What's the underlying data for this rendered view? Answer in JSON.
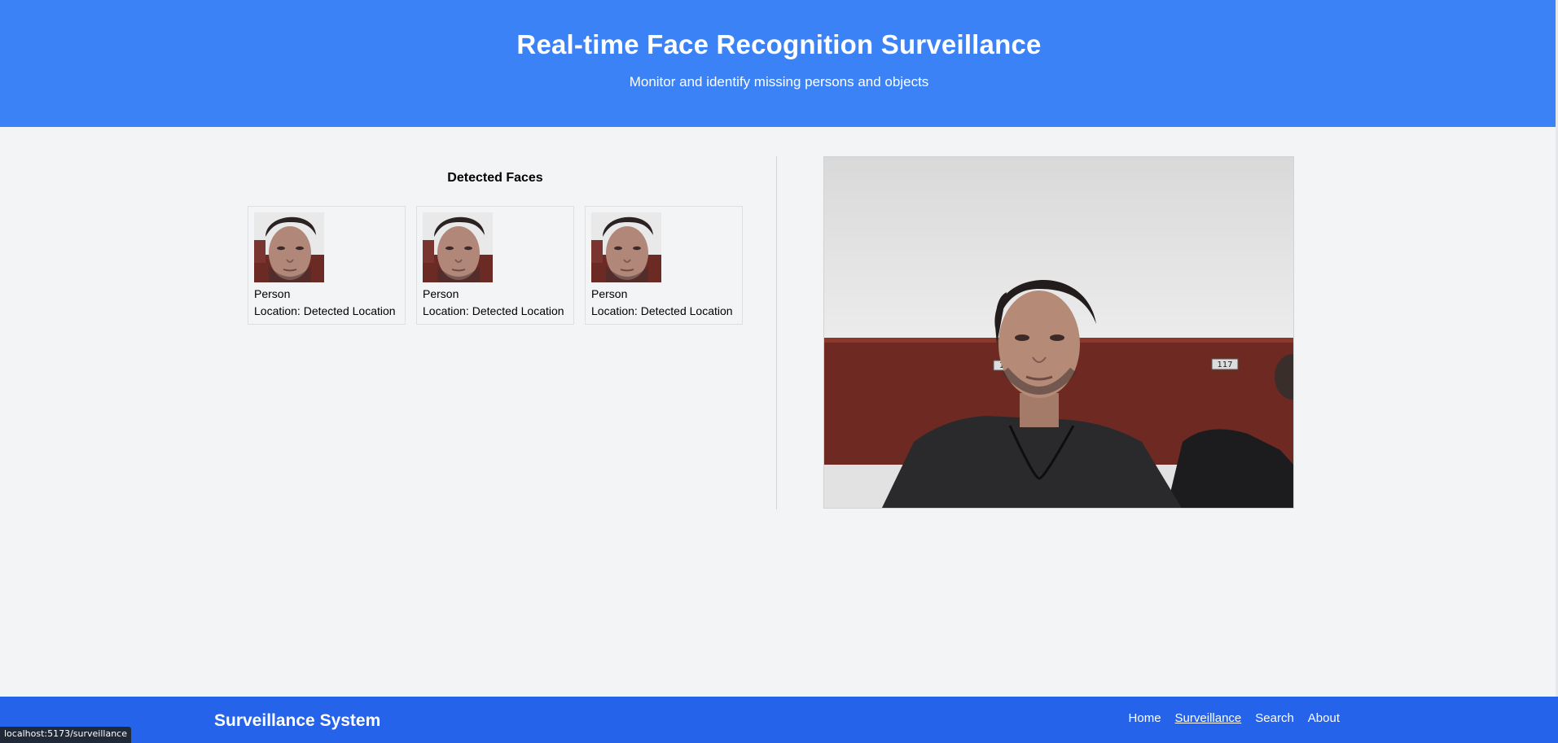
{
  "header": {
    "title": "Real-time Face Recognition Surveillance",
    "subtitle": "Monitor and identify missing persons and objects"
  },
  "detected_faces": {
    "title": "Detected Faces",
    "items": [
      {
        "name": "Person",
        "location": "Location: Detected Location"
      },
      {
        "name": "Person",
        "location": "Location: Detected Location"
      },
      {
        "name": "Person",
        "location": "Location: Detected Location"
      }
    ]
  },
  "camera_feed": {
    "seat_labels": [
      "1",
      "117"
    ]
  },
  "footer": {
    "brand": "Surveillance System",
    "nav": [
      {
        "label": "Home",
        "active": false
      },
      {
        "label": "Surveillance",
        "active": true
      },
      {
        "label": "Search",
        "active": false
      },
      {
        "label": "About",
        "active": false
      }
    ]
  },
  "status_bar": {
    "url": "localhost:5173/surveillance"
  },
  "colors": {
    "header_bg": "#3b82f6",
    "footer_bg": "#2563eb",
    "page_bg": "#f3f4f6"
  }
}
